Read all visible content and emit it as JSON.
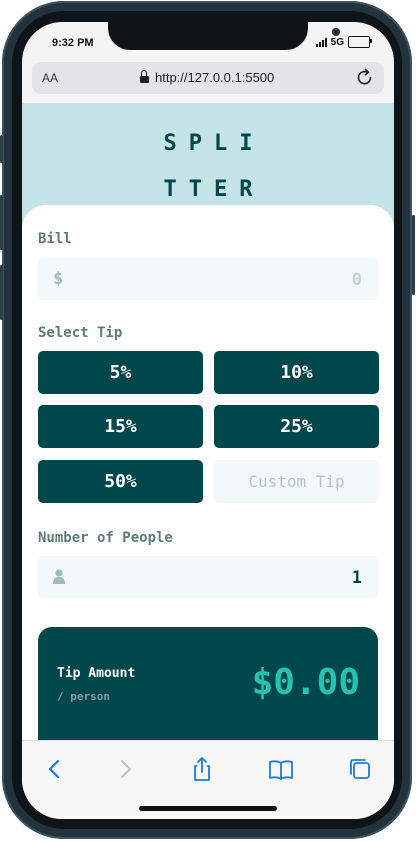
{
  "status_bar": {
    "time": "9:32 PM",
    "network": "5G"
  },
  "browser": {
    "text_size_label": "AA",
    "url": "http://127.0.0.1:5500"
  },
  "app": {
    "logo_line1": "SPLI",
    "logo_line2": "TTER",
    "bill": {
      "label": "Bill",
      "icon": "$",
      "value": "0"
    },
    "select_tip": {
      "label": "Select Tip",
      "options": [
        "5%",
        "10%",
        "15%",
        "25%",
        "50%"
      ],
      "custom_placeholder": "Custom Tip"
    },
    "people": {
      "label": "Number of People",
      "icon": "person-icon",
      "value": "1"
    },
    "result": {
      "tip_amount_label": "Tip Amount",
      "per_person_label": "/ person",
      "tip_amount_value": "$0.00"
    }
  },
  "colors": {
    "dark_cyan": "#00474b",
    "light_cyan": "#c5e4e7",
    "accent": "#26c2ae",
    "field_bg": "#f3f9fa",
    "label_gray": "#5e7a7d",
    "safari_blue": "#1f7ae0"
  },
  "toolbar": {
    "icons": [
      "back-icon",
      "forward-icon",
      "share-icon",
      "bookmarks-icon",
      "tabs-icon"
    ]
  }
}
